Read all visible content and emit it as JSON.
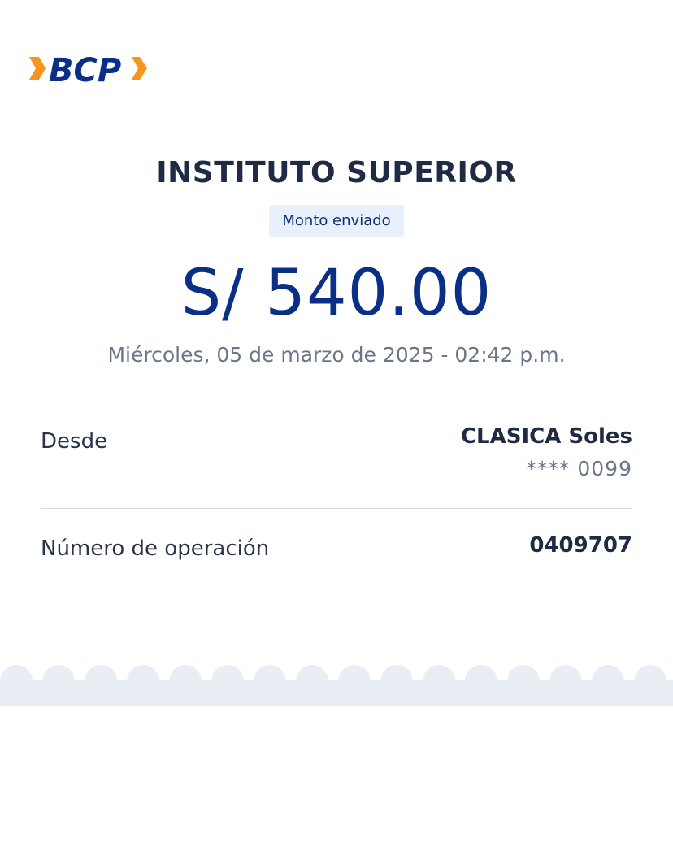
{
  "brand": {
    "logo_text": "BCP",
    "colors": {
      "navy": "#0a2f86",
      "orange": "#f7941d",
      "badge_bg": "#e8f1fb",
      "scallop": "#e9eef5"
    }
  },
  "receipt": {
    "recipient": "INSTITUTO SUPERIOR",
    "badge_label": "Monto enviado",
    "amount": "S/ 540.00",
    "datetime": "Miércoles, 05 de marzo de 2025 - 02:42 p.m."
  },
  "details": {
    "from_label": "Desde",
    "account_name": "CLASICA Soles",
    "account_number": "**** 0099",
    "operation_label": "Número de operación",
    "operation_number": "0409707"
  }
}
